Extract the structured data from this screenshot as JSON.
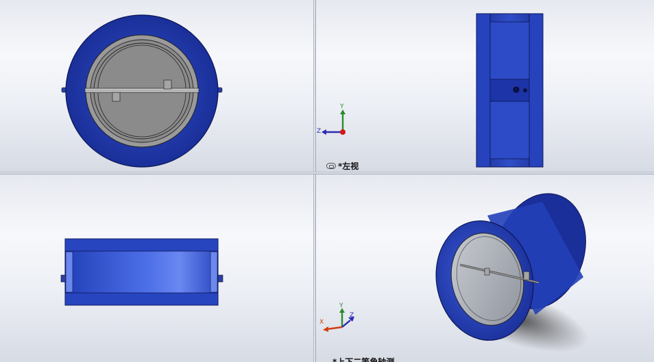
{
  "viewports": {
    "top_right": {
      "view_name": "*左视"
    },
    "bottom_right": {
      "view_name": "*上下二等角轴测"
    }
  },
  "axes_triad": {
    "top_right": {
      "x_label": "",
      "y_label": "Y",
      "z_label": "Z"
    },
    "bottom_right": {
      "x_label": "X",
      "y_label": "Y",
      "z_label": "Z"
    }
  },
  "colors": {
    "body_blue": "#1f3fb0",
    "disc_gray": "#8a8a8a",
    "axis_x": "#d04010",
    "axis_y": "#2a8a2a",
    "axis_z": "#2a2ab0",
    "divider": "#9aa3b4"
  },
  "icons": {
    "view_link": "link-icon",
    "triad": "coordinate-triad-icon"
  }
}
